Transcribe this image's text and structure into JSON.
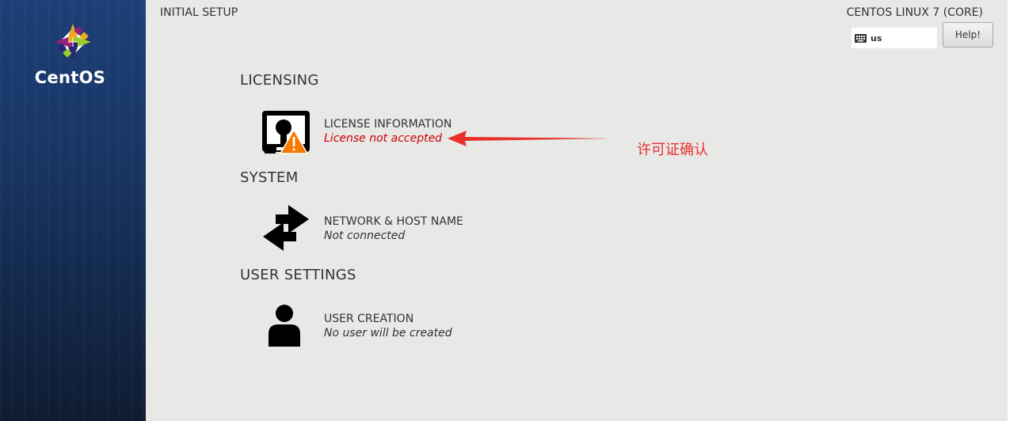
{
  "sidebar": {
    "logo_text": "CentOS"
  },
  "header": {
    "setup_title": "INITIAL SETUP",
    "os_title": "CENTOS LINUX 7 (CORE)",
    "keyboard_layout": "us",
    "help_label": "Help!"
  },
  "sections": {
    "licensing": {
      "title": "LICENSING",
      "license": {
        "title": "LICENSE INFORMATION",
        "status": "License not accepted"
      }
    },
    "system": {
      "title": "SYSTEM",
      "network": {
        "title": "NETWORK & HOST NAME",
        "status": "Not connected"
      }
    },
    "user_settings": {
      "title": "USER SETTINGS",
      "user": {
        "title": "USER CREATION",
        "status": "No user will be created"
      }
    }
  },
  "annotation": {
    "text": "许可证确认",
    "color": "#e8302a"
  },
  "colors": {
    "warning": "#cc0000",
    "text": "#2e3436",
    "background": "#e8e8e7",
    "sidebar": "#1d4078"
  },
  "icons": {
    "license": "license-warning-icon",
    "network": "network-arrows-icon",
    "user": "user-silhouette-icon",
    "keyboard": "keyboard-icon",
    "logo": "centos-logo-icon"
  }
}
